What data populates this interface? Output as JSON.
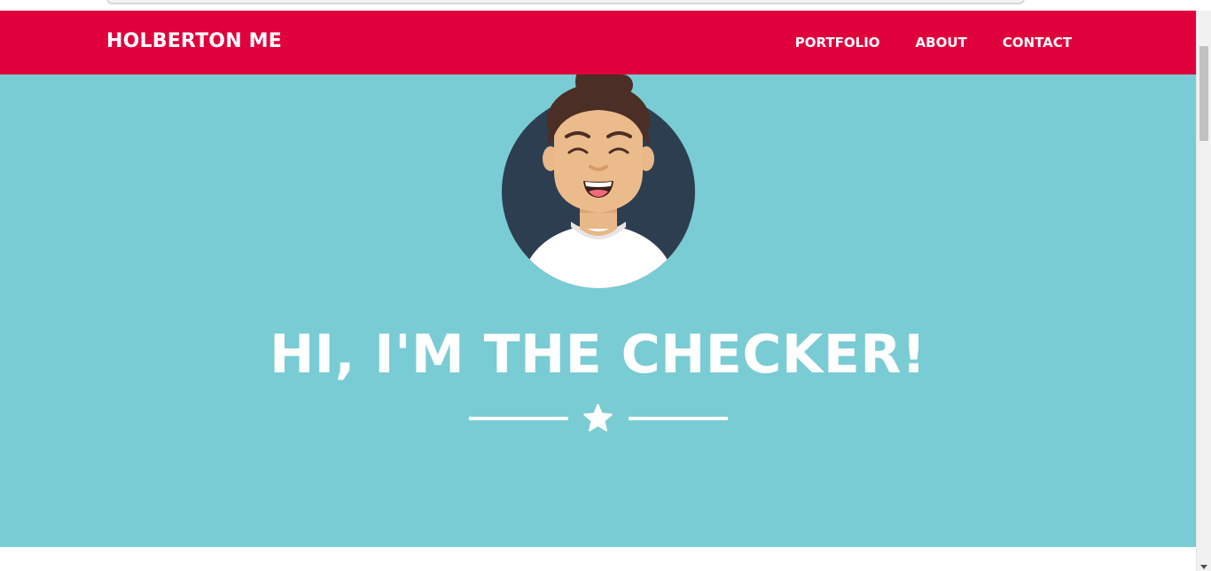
{
  "navbar": {
    "brand": "HOLBERTON ME",
    "links": [
      "PORTFOLIO",
      "ABOUT",
      "CONTACT"
    ]
  },
  "hero": {
    "title": "HI, I'M THE CHECKER!",
    "avatar_icon": "smiling-person-avatar",
    "divider_icon": "star-icon"
  },
  "colors": {
    "navbar": "#e0003c",
    "hero": "#79ccd3",
    "avatar_circle": "#2d3e50",
    "text": "#ffffff"
  }
}
